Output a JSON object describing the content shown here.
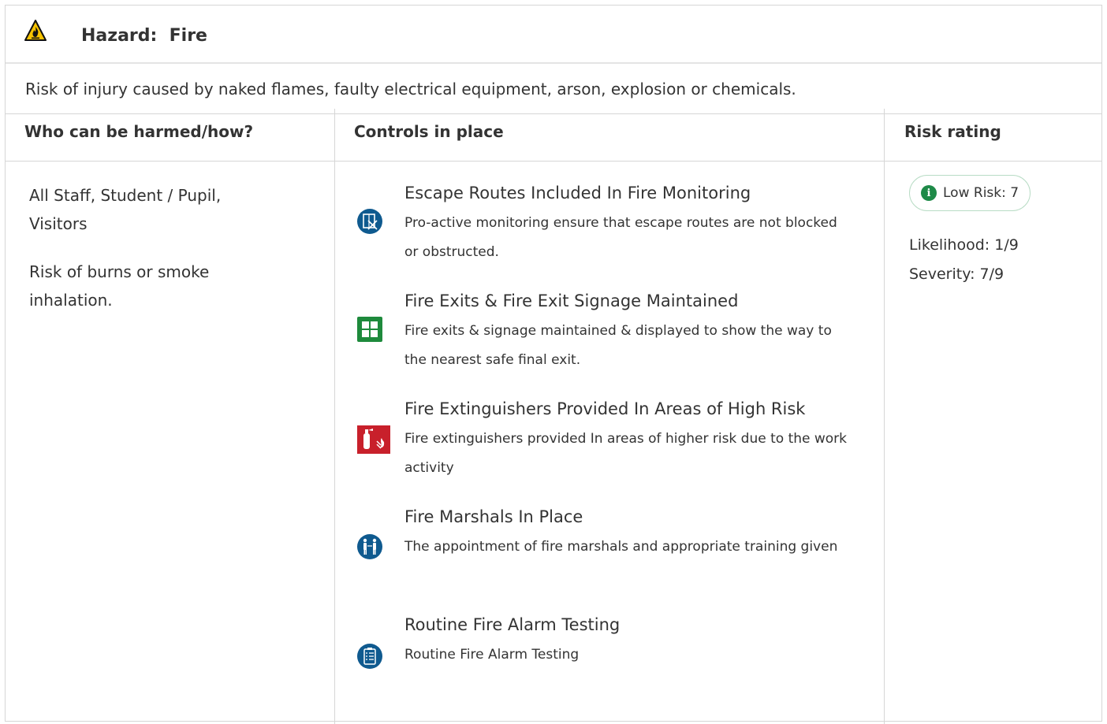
{
  "hazard": {
    "title": "Hazard:  Fire",
    "description": "Risk of injury caused by naked flames, faulty electrical equipment, arson, explosion or chemicals."
  },
  "columns": {
    "who": "Who can be harmed/how?",
    "controls": "Controls in place",
    "risk": "Risk rating"
  },
  "harm": {
    "who": "All Staff, Student / Pupil, Visitors",
    "how": "Risk of burns or smoke inhalation."
  },
  "controls": [
    {
      "title": "Escape Routes Included In Fire Monitoring",
      "description": "Pro-active monitoring ensure that escape routes are not blocked or obstructed.",
      "icon": "escape-route-icon"
    },
    {
      "title": "Fire Exits & Fire Exit Signage Maintained",
      "description": "Fire exits & signage maintained & displayed to show the way to the nearest safe final exit.",
      "icon": "fire-exit-icon"
    },
    {
      "title": "Fire Extinguishers Provided In Areas of High Risk",
      "description": "Fire extinguishers provided In areas of higher risk due to the work activity",
      "icon": "fire-extinguisher-icon"
    },
    {
      "title": "Fire Marshals In Place",
      "description": "The appointment of fire marshals and appropriate training given",
      "icon": "fire-marshal-icon"
    },
    {
      "title": "Routine Fire Alarm Testing",
      "description": "Routine Fire Alarm Testing",
      "icon": "clipboard-checklist-icon"
    }
  ],
  "risk": {
    "badge": "Low Risk: 7",
    "likelihood": "Likelihood: 1/9",
    "severity": "Severity: 7/9"
  },
  "colors": {
    "blue": "#0f5a8f",
    "green": "#1e8a3c",
    "red": "#c8202b",
    "warning_yellow": "#f7c300"
  }
}
